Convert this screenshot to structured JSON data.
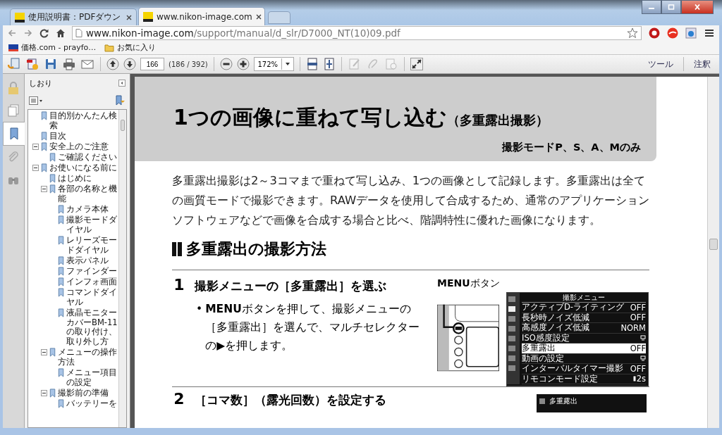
{
  "browser": {
    "tabs": [
      {
        "title": "使用説明書：PDFダウン",
        "selected": false
      },
      {
        "title": "www.nikon-image.com",
        "selected": true
      }
    ],
    "url_host": "www.nikon-image.com",
    "url_path": "/support/manual/d_slr/D7000_NT(10)09.pdf",
    "bookmarks": [
      {
        "label": "価格.com - prayfo…",
        "kind": "site"
      },
      {
        "label": "お気に入り",
        "kind": "folder"
      }
    ]
  },
  "pdf_toolbar": {
    "buttons": [
      {
        "disabled": false
      },
      {
        "disabled": false
      },
      {
        "disabled": false
      },
      {
        "disabled": false
      },
      {
        "disabled": false
      }
    ],
    "page_number": "166",
    "page_count": "(186 / 392)",
    "zoom": "172%",
    "edit_buttons": [
      {
        "disabled": true
      },
      {
        "disabled": true
      },
      {
        "disabled": true
      }
    ],
    "right_links": [
      "ツール",
      "注釈"
    ]
  },
  "nav_rail": [
    {
      "selected": false
    },
    {
      "selected": false
    },
    {
      "selected": true
    },
    {
      "selected": false
    },
    {
      "selected": false
    }
  ],
  "sidebar": {
    "title": "しおり",
    "tree": [
      {
        "label": "目的別かんたん検索"
      },
      {
        "label": "目次"
      },
      {
        "label": "安全上のご注意",
        "expanded": true,
        "children": [
          {
            "label": "ご確認ください"
          }
        ]
      },
      {
        "label": "お使いになる前に",
        "expanded": true,
        "children": [
          {
            "label": "はじめに"
          },
          {
            "label": "各部の名称と機能",
            "expanded": true,
            "children": [
              {
                "label": "カメラ本体"
              },
              {
                "label": "撮影モードダイヤル"
              },
              {
                "label": "レリーズモードダイヤル"
              },
              {
                "label": "表示パネル"
              },
              {
                "label": "ファインダー"
              },
              {
                "label": "インフォ画面"
              },
              {
                "label": "コマンドダイヤル"
              },
              {
                "label": "液晶モニターカバーBM-11の取り付け、取り外し方"
              }
            ]
          },
          {
            "label": "メニューの操作方法",
            "expanded": true,
            "children": [
              {
                "label": "メニュー項目の設定"
              }
            ]
          },
          {
            "label": "撮影前の準備",
            "expanded": true,
            "children": [
              {
                "label": "バッテリーを"
              }
            ]
          }
        ]
      }
    ]
  },
  "page": {
    "title": "1つの画像に重ねて写し込む",
    "title_note": "（多重露出撮影）",
    "modes": "撮影モードP、S、A、Mのみ",
    "intro": "多重露出撮影は2～3コマまで重ねて写し込み、1つの画像として記録します。多重露出は全ての画質モードで撮影できます。RAWデータを使用して合成するため、通常のアプリケーションソフトウェアなどで画像を合成する場合と比べ、階調特性に優れた画像になります。",
    "section": "多重露出の撮影方法",
    "steps": [
      {
        "number": "1",
        "title": "撮影メニューの［多重露出］を選ぶ",
        "bullet": "•",
        "text": "**MENU**ボタンを押して、撮影メニューの［多重露出］を選んで、マルチセレクターの▶を押します。",
        "figure_label": "**MENU**ボタン",
        "menu": {
          "title": "撮影メニュー",
          "rows": [
            {
              "label": "アクティブD-ライティング",
              "value": "OFF",
              "kind": "text",
              "selected": false
            },
            {
              "label": "長秒時ノイズ低減",
              "value": "OFF",
              "kind": "text",
              "selected": false
            },
            {
              "label": "高感度ノイズ低減",
              "value": "NORM",
              "kind": "text",
              "selected": false
            },
            {
              "label": "ISO感度設定",
              "kind": "submenu",
              "selected": false
            },
            {
              "label": "多重露出",
              "value": "OFF",
              "kind": "text",
              "selected": true
            },
            {
              "label": "動画の設定",
              "kind": "submenu",
              "selected": false
            },
            {
              "label": "インターバルタイマー撮影",
              "value": "OFF",
              "kind": "text",
              "selected": false
            },
            {
              "label": "リモコンモード設定",
              "value": "2s",
              "kind": "remote",
              "selected": false
            }
          ]
        }
      },
      {
        "number": "2",
        "title": "［コマ数］（露光回数）を設定する",
        "menu": {
          "title": "多重露出"
        }
      }
    ]
  }
}
